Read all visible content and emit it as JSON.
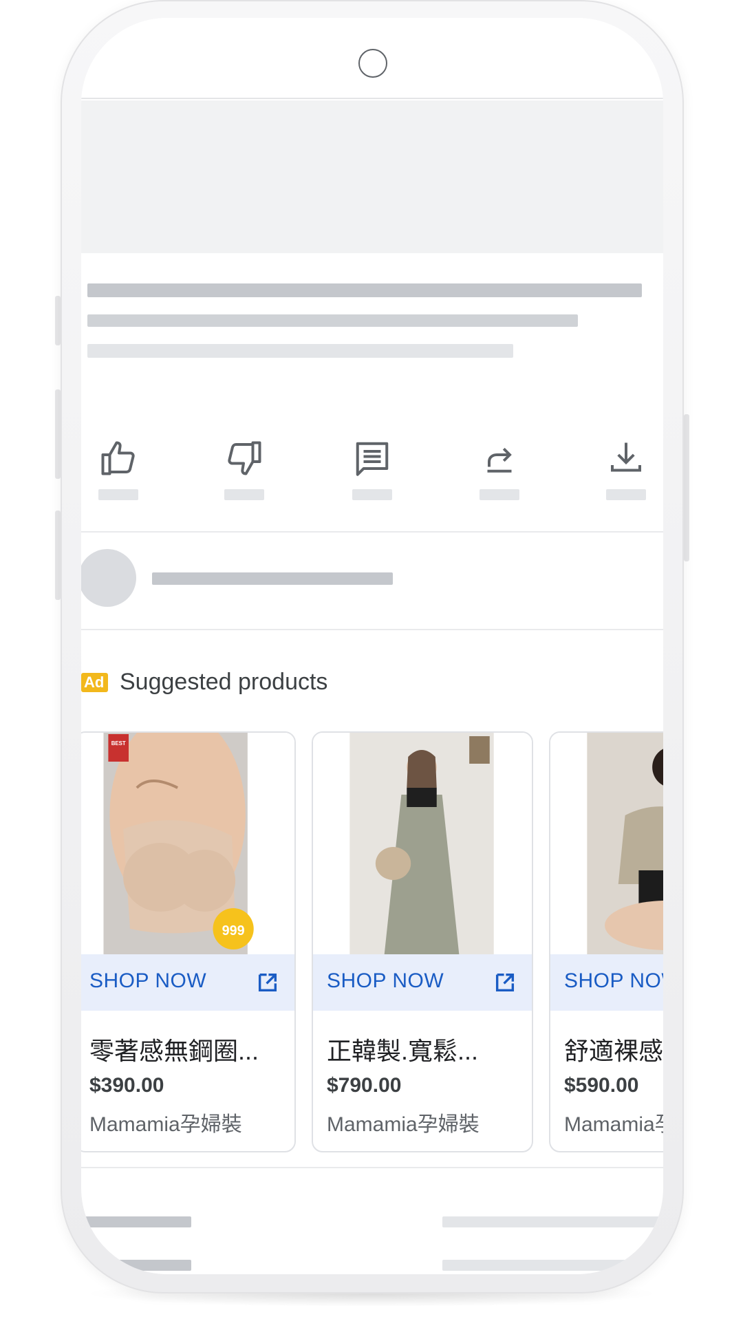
{
  "ad_section": {
    "badge": "Ad",
    "title": "Suggested products"
  },
  "products": [
    {
      "cta": "SHOP NOW",
      "title": "零著感無鋼圈...",
      "price": "$390.00",
      "seller": "Mamamia孕婦裝",
      "sticker": "999",
      "tag": "BEST"
    },
    {
      "cta": "SHOP NOW",
      "title": "正韓製.寬鬆...",
      "price": "$790.00",
      "seller": "Mamamia孕婦裝"
    },
    {
      "cta": "SHOP NOW",
      "title": "舒適裸感...",
      "price": "$590.00",
      "seller": "Mamamia孕婦裝"
    }
  ],
  "actions": [
    "thumbs-up-icon",
    "thumbs-down-icon",
    "comment-icon",
    "share-icon",
    "download-icon"
  ],
  "colors": {
    "ad_badge": "#f2b81c",
    "cta_text": "#1a5cc4",
    "cta_bg": "#e8eefb",
    "skeleton": "#c4c7cc"
  }
}
